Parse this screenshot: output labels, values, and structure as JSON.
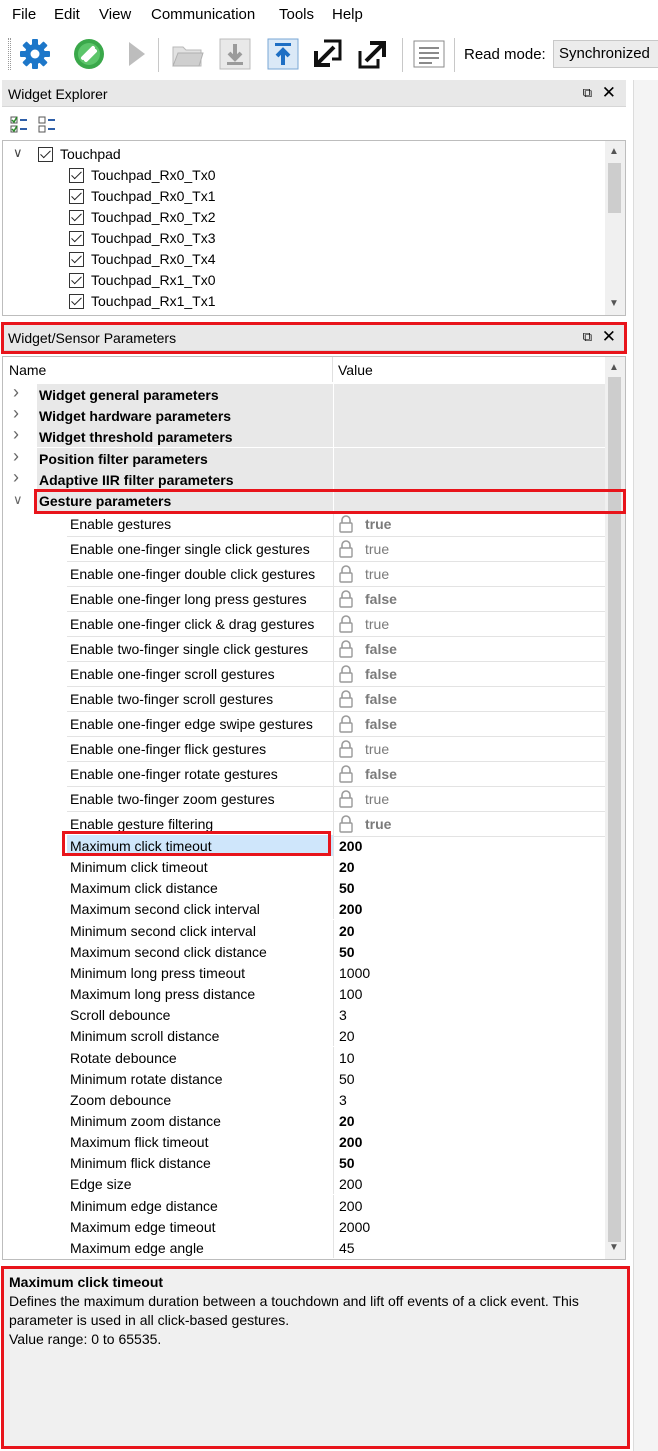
{
  "menu": [
    "File",
    "Edit",
    "View",
    "Communication",
    "Tools",
    "Help"
  ],
  "toolbar": {
    "icons": [
      "gear-icon",
      "connect-icon",
      "start-icon",
      "open-folder-icon",
      "download-icon",
      "upload-icon",
      "import-icon",
      "export-icon",
      "log-icon"
    ],
    "read_mode_label": "Read mode:",
    "read_mode_value": "Synchronized"
  },
  "widget_explorer": {
    "title": "Widget Explorer",
    "root": "Touchpad",
    "items": [
      "Touchpad_Rx0_Tx0",
      "Touchpad_Rx0_Tx1",
      "Touchpad_Rx0_Tx2",
      "Touchpad_Rx0_Tx3",
      "Touchpad_Rx0_Tx4",
      "Touchpad_Rx1_Tx0",
      "Touchpad_Rx1_Tx1"
    ]
  },
  "params": {
    "title": "Widget/Sensor Parameters",
    "col_name": "Name",
    "col_value": "Value",
    "groups": [
      "Widget general parameters",
      "Widget hardware parameters",
      "Widget threshold parameters",
      "Position filter parameters",
      "Adaptive IIR filter parameters",
      "Gesture parameters"
    ],
    "locked_rows": [
      {
        "name": "Enable gestures",
        "value": "true",
        "bold": true
      },
      {
        "name": "Enable one-finger single click gestures",
        "value": "true",
        "bold": false
      },
      {
        "name": "Enable one-finger double click gestures",
        "value": "true",
        "bold": false
      },
      {
        "name": "Enable one-finger long press gestures",
        "value": "false",
        "bold": true
      },
      {
        "name": "Enable one-finger click & drag gestures",
        "value": "true",
        "bold": false
      },
      {
        "name": "Enable two-finger single click gestures",
        "value": "false",
        "bold": true
      },
      {
        "name": "Enable one-finger scroll gestures",
        "value": "false",
        "bold": true
      },
      {
        "name": "Enable two-finger scroll gestures",
        "value": "false",
        "bold": true
      },
      {
        "name": "Enable one-finger edge swipe gestures",
        "value": "false",
        "bold": true
      },
      {
        "name": "Enable one-finger flick gestures",
        "value": "true",
        "bold": false
      },
      {
        "name": "Enable one-finger rotate gestures",
        "value": "false",
        "bold": true
      },
      {
        "name": "Enable two-finger zoom gestures",
        "value": "true",
        "bold": false
      },
      {
        "name": "Enable gesture filtering",
        "value": "true",
        "bold": true
      }
    ],
    "value_rows": [
      {
        "name": "Maximum click timeout",
        "value": "200",
        "bold": true
      },
      {
        "name": "Minimum click timeout",
        "value": "20",
        "bold": true
      },
      {
        "name": "Maximum click distance",
        "value": "50",
        "bold": true
      },
      {
        "name": "Maximum second click interval",
        "value": "200",
        "bold": true
      },
      {
        "name": "Minimum second click interval",
        "value": "20",
        "bold": true
      },
      {
        "name": "Maximum second click distance",
        "value": "50",
        "bold": true
      },
      {
        "name": "Minimum long press timeout",
        "value": "1000",
        "bold": false
      },
      {
        "name": "Maximum long press distance",
        "value": "100",
        "bold": false
      },
      {
        "name": "Scroll debounce",
        "value": "3",
        "bold": false
      },
      {
        "name": "Minimum scroll distance",
        "value": "20",
        "bold": false
      },
      {
        "name": "Rotate debounce",
        "value": "10",
        "bold": false
      },
      {
        "name": "Minimum rotate distance",
        "value": "50",
        "bold": false
      },
      {
        "name": "Zoom debounce",
        "value": "3",
        "bold": false
      },
      {
        "name": "Minimum zoom distance",
        "value": "20",
        "bold": true
      },
      {
        "name": "Maximum flick timeout",
        "value": "200",
        "bold": true
      },
      {
        "name": "Minimum flick distance",
        "value": "50",
        "bold": true
      },
      {
        "name": "Edge size",
        "value": "200",
        "bold": false
      },
      {
        "name": "Minimum edge distance",
        "value": "200",
        "bold": false
      },
      {
        "name": "Maximum edge timeout",
        "value": "2000",
        "bold": false
      },
      {
        "name": "Maximum edge angle",
        "value": "45",
        "bold": false
      }
    ]
  },
  "description": {
    "title": "Maximum click timeout",
    "body": "Defines the maximum duration between a touchdown and lift off events of a click event. This parameter is used in all click-based gestures.",
    "range": "Value range: 0 to 65535."
  },
  "colors": {
    "highlight": "#e8141b",
    "selection": "#cfe6fb"
  }
}
